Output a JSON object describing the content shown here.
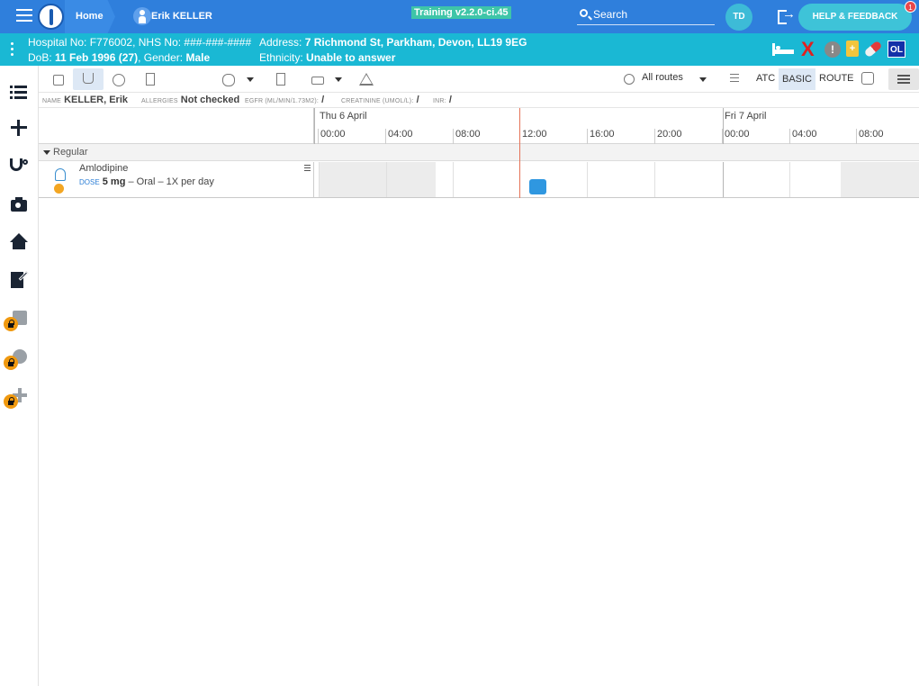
{
  "topbar": {
    "home_label": "Home",
    "patient_label": "Erik KELLER",
    "version_label": "Training v2.2.0-ci.45",
    "search_label": "Search",
    "user_initials": "TD",
    "help_label": "HELP & FEEDBACK",
    "notification_count": "1"
  },
  "banner": {
    "line1": "Hospital No: F776002, NHS No: ###-###-####",
    "dob_label": "DoB: ",
    "dob_value": "11 Feb 1996 (27)",
    "gender_label": ", Gender: ",
    "gender_value": "Male",
    "address_label": "Address: ",
    "address_value": "7 Richmond St, Parkham, Devon, LL19 9EG",
    "ethnicity_label": "Ethnicity: ",
    "ethnicity_value": "Unable to answer",
    "alert_glyph": "!",
    "clipboard_glyph": "+",
    "ol_label": "OL",
    "x_glyph": "X"
  },
  "toolbar": {
    "routes_label": "All routes",
    "atc_label": "ATC",
    "basic_label": "BASIC",
    "route_label": "ROUTE"
  },
  "infostrip": {
    "name_label": "NAME",
    "name_value": "KELLER, Erik",
    "allergies_label": "ALLERGIES",
    "allergies_value": "Not checked",
    "egfr_label": "EGFR (ML/MIN/1.73M2):",
    "egfr_value": "/",
    "creatinine_label": "CREATININE (UMOL/L):",
    "creatinine_value": "/",
    "inr_label": "INR:",
    "inr_value": "/"
  },
  "timeline": {
    "days": [
      "Thu 6 April",
      "Fri 7 April"
    ],
    "hours": [
      "00:00",
      "04:00",
      "08:00",
      "12:00",
      "16:00",
      "20:00",
      "00:00",
      "04:00",
      "08:00"
    ]
  },
  "group": {
    "label": "Regular"
  },
  "medication": {
    "name": "Amlodipine",
    "dose_label": "DOSE",
    "dose_value": "5 mg",
    "route_freq": " – Oral – 1X per day"
  },
  "colors": {
    "topbar": "#2f7fdc",
    "banner": "#1ab8d4",
    "now_line": "#e57257",
    "dose_marker": "#2f97e0"
  }
}
